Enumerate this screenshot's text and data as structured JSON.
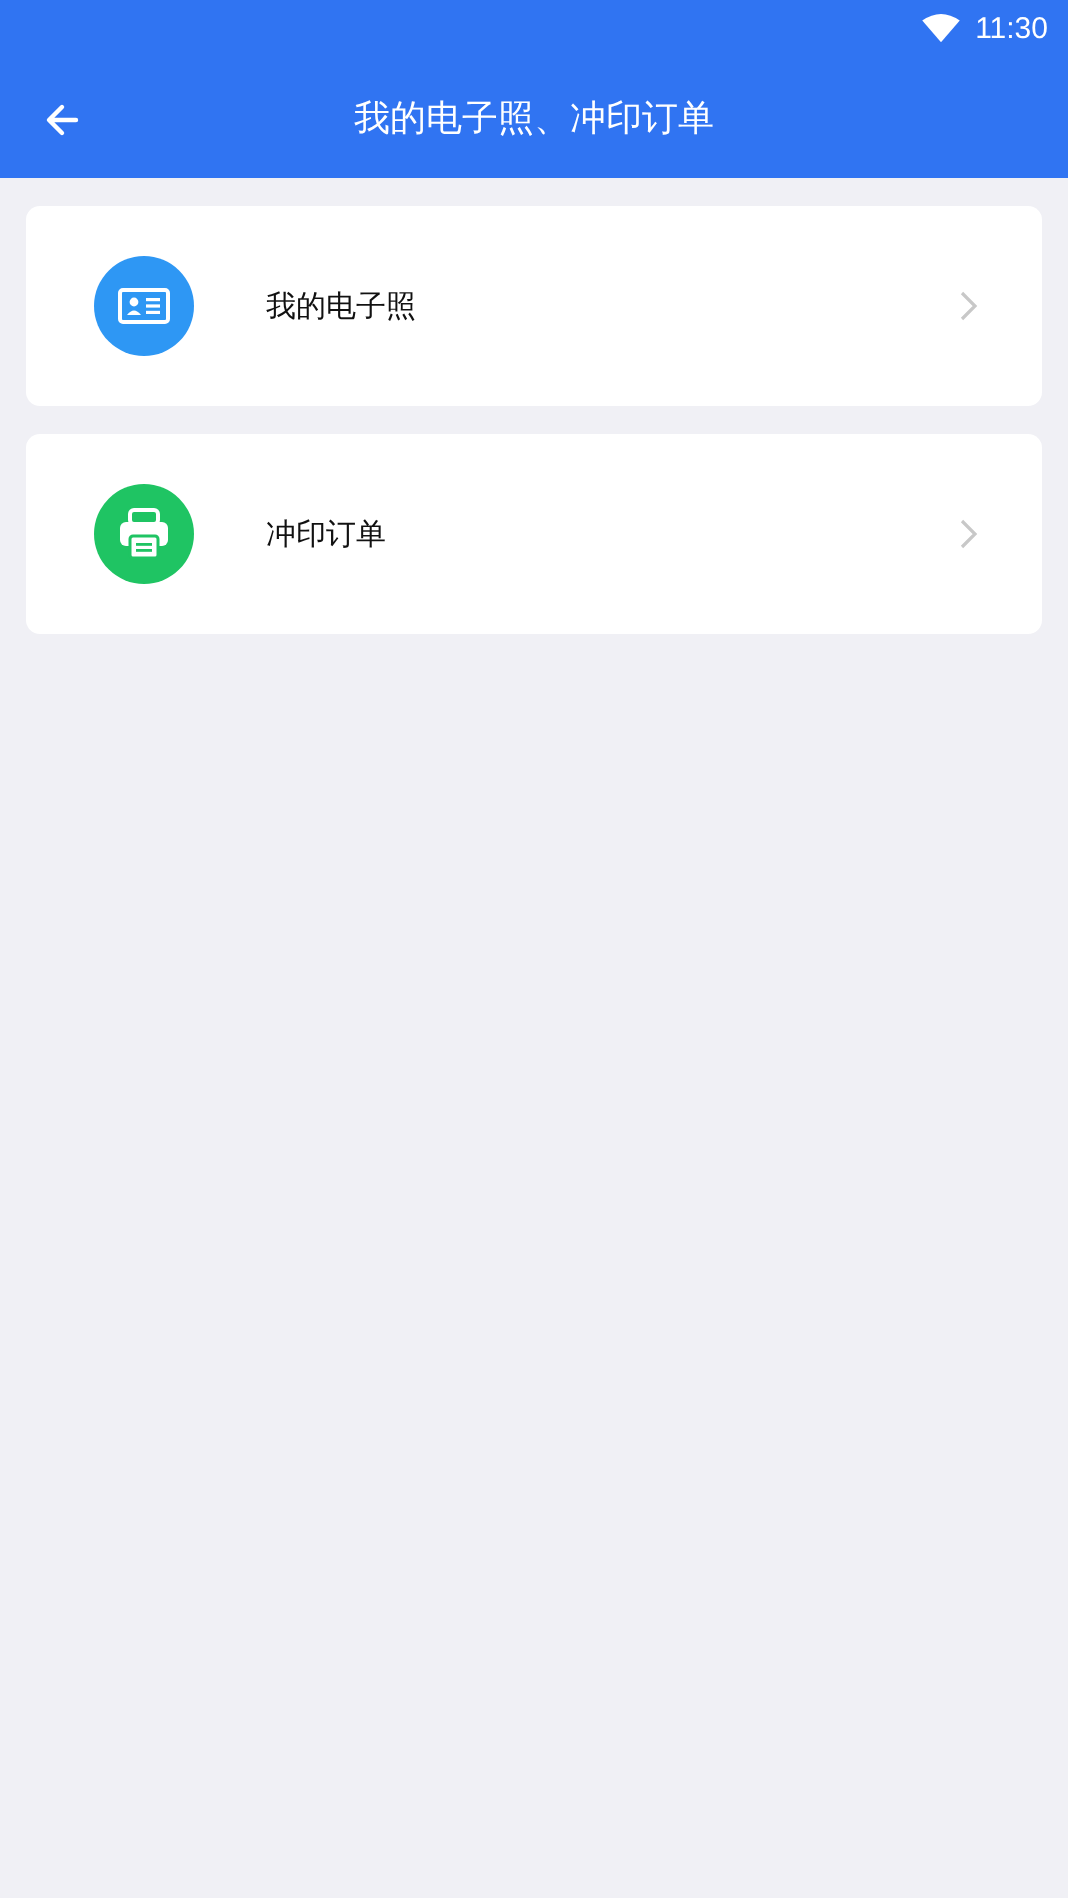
{
  "status_bar": {
    "time": "11:30"
  },
  "header": {
    "title": "我的电子照、冲印订单"
  },
  "items": [
    {
      "kind": "id-card",
      "label": "我的电子照",
      "color": "#2e97f4"
    },
    {
      "kind": "printer",
      "label": "冲印订单",
      "color": "#1fc463"
    }
  ]
}
